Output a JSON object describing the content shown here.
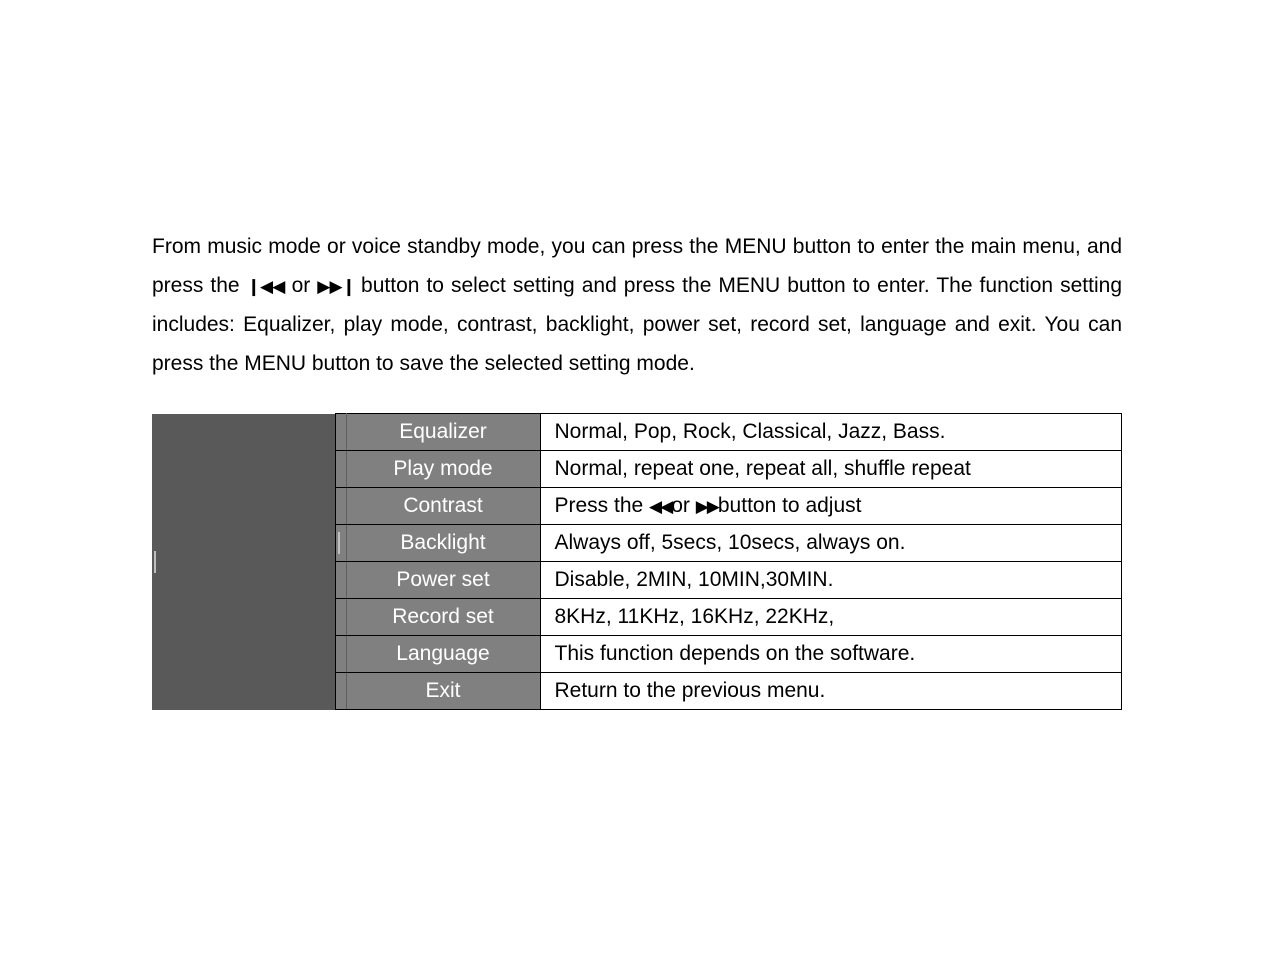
{
  "intro": {
    "text_before_prev": "From music mode or voice standby mode, you can press the MENU button to enter the main menu, and press the ",
    "prev_glyph": "❙◀◀",
    "text_between": " or ",
    "next_glyph": "▶▶❙",
    "text_after_next": " button to select setting and press the MENU button to enter. The function setting includes: Equalizer, play mode, contrast, backlight, power set, record set, language and exit. You can press the MENU button to save the selected setting mode."
  },
  "contrast_desc": {
    "before": "Press the ",
    "rew_glyph": "◀◀",
    "mid": "or ",
    "ff_glyph": "▶▶",
    "after": "button to adjust"
  },
  "rows": [
    {
      "name": "Equalizer",
      "desc": "Normal, Pop, Rock, Classical, Jazz, Bass."
    },
    {
      "name": "Play mode",
      "desc": "Normal, repeat one, repeat all, shuffle repeat"
    },
    {
      "name": "Contrast",
      "desc": "__CONTRAST__"
    },
    {
      "name": "Backlight",
      "desc": "Always off, 5secs, 10secs, always on."
    },
    {
      "name": "Power set",
      "desc": "Disable, 2MIN, 10MIN,30MIN."
    },
    {
      "name": "Record set",
      "desc": "8KHz, 11KHz, 16KHz, 22KHz,"
    },
    {
      "name": "Language",
      "desc": "This function depends on the software."
    },
    {
      "name": "Exit",
      "desc": "Return to the previous menu."
    }
  ]
}
